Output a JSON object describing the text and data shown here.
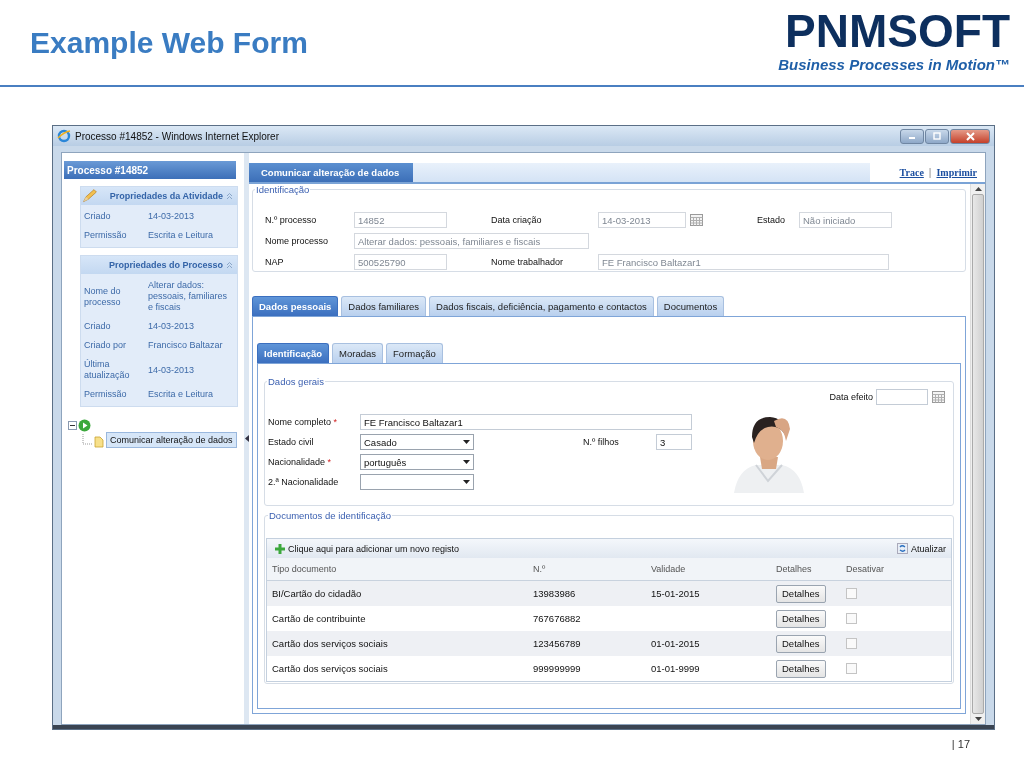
{
  "slide": {
    "title": "Example Web Form",
    "logo": "PNMSOFT",
    "tagline": "Business Processes in Motion™",
    "page_number": "| 17"
  },
  "window": {
    "title": "Processo #14852 - Windows Internet Explorer"
  },
  "sidebar": {
    "header": "Processo #14852",
    "sections": [
      {
        "title": "Propriedades da Atividade",
        "expanded": true,
        "rows": [
          {
            "label": "Criado",
            "value": "14-03-2013"
          },
          {
            "label": "Permissão",
            "value": "Escrita e Leitura"
          }
        ]
      },
      {
        "title": "Propriedades do Processo",
        "expanded": true,
        "rows": [
          {
            "label": "Nome do processo",
            "value": "Alterar dados: pessoais, familiares e fiscais"
          },
          {
            "label": "Criado",
            "value": "14-03-2013"
          },
          {
            "label": "Criado por",
            "value": "Francisco Baltazar"
          },
          {
            "label": "Última atualização",
            "value": "14-03-2013"
          },
          {
            "label": "Permissão",
            "value": "Escrita e Leitura"
          }
        ]
      }
    ],
    "tree": {
      "expanded": true,
      "children": [
        {
          "label": "Comunicar alteração de dados",
          "selected": true
        }
      ]
    }
  },
  "main": {
    "tab": "Comunicar alteração de dados",
    "links": [
      "Trace",
      "Imprimir"
    ],
    "link_separator": "|",
    "identificacao": {
      "legend": "Identificação",
      "rows": [
        [
          {
            "label": "N.º processo",
            "kind": "text",
            "value": "14852",
            "disabled": true
          },
          {
            "label": "Data criação",
            "kind": "date",
            "value": "14-03-2013",
            "disabled": true
          },
          {
            "label": "Estado",
            "kind": "text",
            "value": "Não iniciado",
            "disabled": true
          }
        ],
        [
          {
            "label": "Nome processo",
            "kind": "text",
            "value": "Alterar dados: pessoais, familiares e fiscais",
            "disabled": true
          }
        ],
        [
          {
            "label": "NAP",
            "kind": "text",
            "value": "500525790",
            "disabled": true
          },
          {
            "label": "Nome trabalhador",
            "kind": "text",
            "value": "FE Francisco Baltazar1",
            "disabled": true
          }
        ]
      ]
    },
    "tabs": [
      {
        "label": "Dados pessoais",
        "selected": true
      },
      {
        "label": "Dados familiares",
        "selected": false
      },
      {
        "label": "Dados fiscais, deficiência, pagamento e contactos",
        "selected": false
      },
      {
        "label": "Documentos",
        "selected": false
      }
    ],
    "subtabs": [
      {
        "label": "Identificação",
        "selected": true
      },
      {
        "label": "Moradas",
        "selected": false
      },
      {
        "label": "Formação",
        "selected": false
      }
    ],
    "dados_gerais": {
      "legend": "Dados gerais",
      "date_field": {
        "label": "Data efeito",
        "kind": "date"
      },
      "rows": [
        [
          {
            "label": "Nome completo",
            "required_mark": "*",
            "kind": "text",
            "value": "FE Francisco Baltazar1"
          }
        ],
        [
          {
            "label": "Estado civil",
            "kind": "select",
            "value": "Casado"
          },
          {
            "label": "N.º filhos",
            "kind": "text",
            "value": "3"
          }
        ],
        [
          {
            "label": "Nacionalidade",
            "required_mark": "*",
            "kind": "select",
            "value": "português"
          }
        ],
        [
          {
            "label": "2.ª Nacionalidade",
            "kind": "select"
          }
        ]
      ]
    },
    "documentos": {
      "legend": "Documentos de identificação",
      "add_label": "Clique aqui para adicionar um novo registo",
      "refresh_label": "Atualizar",
      "columns": [
        "Tipo documento",
        "N.º",
        "Validade",
        "Detalhes",
        "Desativar"
      ],
      "rows": [
        {
          "tipo": "BI/Cartão do cidadão",
          "numero": "13983986",
          "validade": "15-01-2015",
          "details": "Detalhes",
          "checked": false
        },
        {
          "tipo": "Cartão de contribuinte",
          "numero": "767676882",
          "details": "Detalhes",
          "checked": false
        },
        {
          "tipo": "Cartão dos serviços sociais",
          "numero": "123456789",
          "validade": "01-01-2015",
          "details": "Detalhes",
          "checked": false
        },
        {
          "tipo": "Cartão dos serviços sociais",
          "numero": "999999999",
          "validade": "01-01-9999",
          "details": "Detalhes",
          "checked": false
        }
      ]
    }
  }
}
